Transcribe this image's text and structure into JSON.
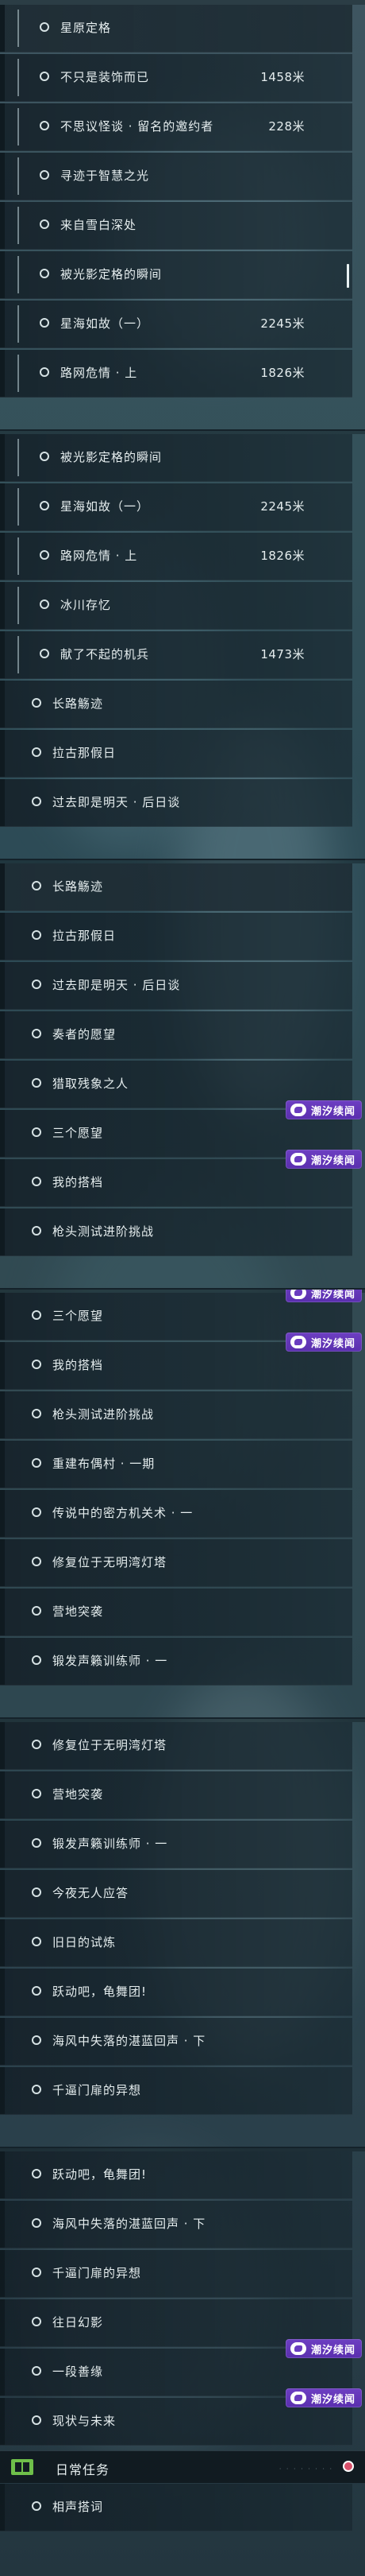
{
  "screens": [
    {
      "rows": [
        {
          "label": "星原定格",
          "indent": 1
        },
        {
          "label": "不只是装饰而已",
          "indent": 1,
          "distance": "1458米"
        },
        {
          "label": "不思议怪谈 · 留名的邀约者",
          "indent": 1,
          "distance": "228米"
        },
        {
          "label": "寻迹于智慧之光",
          "indent": 1
        },
        {
          "label": "来自雪白深处",
          "indent": 1
        },
        {
          "label": "被光影定格的瞬间",
          "indent": 1
        },
        {
          "label": "星海如故（一）",
          "indent": 1,
          "distance": "2245米"
        },
        {
          "label": "路网危情 · 上",
          "indent": 1,
          "distance": "1826米"
        }
      ]
    },
    {
      "rows": [
        {
          "label": "被光影定格的瞬间",
          "indent": 1
        },
        {
          "label": "星海如故（一）",
          "indent": 1,
          "distance": "2245米"
        },
        {
          "label": "路网危情 · 上",
          "indent": 1,
          "distance": "1826米"
        },
        {
          "label": "冰川存忆",
          "indent": 1
        },
        {
          "label": "献了不起的机兵",
          "indent": 1,
          "distance": "1473米"
        },
        {
          "label": "长路觞迹",
          "indent": 0
        },
        {
          "label": "拉古那假日",
          "indent": 0
        },
        {
          "label": "过去即是明天 · 后日谈",
          "indent": 0
        }
      ]
    },
    {
      "rows": [
        {
          "label": "长路觞迹",
          "indent": 0
        },
        {
          "label": "拉古那假日",
          "indent": 0
        },
        {
          "label": "过去即是明天 · 后日谈",
          "indent": 0
        },
        {
          "label": "奏者的愿望",
          "indent": 0
        },
        {
          "label": "猎取残象之人",
          "indent": 0
        },
        {
          "label": "三个愿望",
          "indent": 0
        },
        {
          "label": "我的搭档",
          "indent": 0
        },
        {
          "label": "枪头测试进阶挑战",
          "indent": 0
        }
      ]
    },
    {
      "rows": [
        {
          "label": "三个愿望",
          "indent": 0
        },
        {
          "label": "我的搭档",
          "indent": 0
        },
        {
          "label": "枪头测试进阶挑战",
          "indent": 0
        },
        {
          "label": "重建布偶村 · 一期",
          "indent": 0
        },
        {
          "label": "传说中的密方机关术 · 一",
          "indent": 0
        },
        {
          "label": "修复位于无明湾灯塔",
          "indent": 0
        },
        {
          "label": "营地突袭",
          "indent": 0
        },
        {
          "label": "锻发声籁训练师 · 一",
          "indent": 0
        }
      ]
    },
    {
      "rows": [
        {
          "label": "修复位于无明湾灯塔",
          "indent": 0
        },
        {
          "label": "营地突袭",
          "indent": 0
        },
        {
          "label": "锻发声籁训练师 · 一",
          "indent": 0
        },
        {
          "label": "今夜无人应答",
          "indent": 0
        },
        {
          "label": "旧日的试炼",
          "indent": 0
        },
        {
          "label": "跃动吧，龟舞团!",
          "indent": 0
        },
        {
          "label": "海风中失落的湛蓝回声 · 下",
          "indent": 0
        },
        {
          "label": "千逼门扉的异想",
          "indent": 0
        }
      ]
    },
    {
      "rows": [
        {
          "label": "跃动吧，龟舞团!",
          "indent": 0
        },
        {
          "label": "海风中失落的湛蓝回声 · 下",
          "indent": 0
        },
        {
          "label": "千逼门扉的异想",
          "indent": 0
        },
        {
          "label": "往日幻影",
          "indent": 0
        },
        {
          "label": "一段善缘",
          "indent": 0
        },
        {
          "label": "现状与未来",
          "indent": 0
        }
      ],
      "header": "日常任务",
      "after_header": [
        {
          "label": "相声搭词",
          "indent": 0
        }
      ]
    }
  ],
  "badge_text": "潮汐续闻",
  "header_dots": "· · · · · · · ·",
  "colors": {
    "badge": "#6a3cc0",
    "header_icon": "#6fbf4a",
    "header_gem": "#d8506a",
    "text": "#e6eeef"
  }
}
